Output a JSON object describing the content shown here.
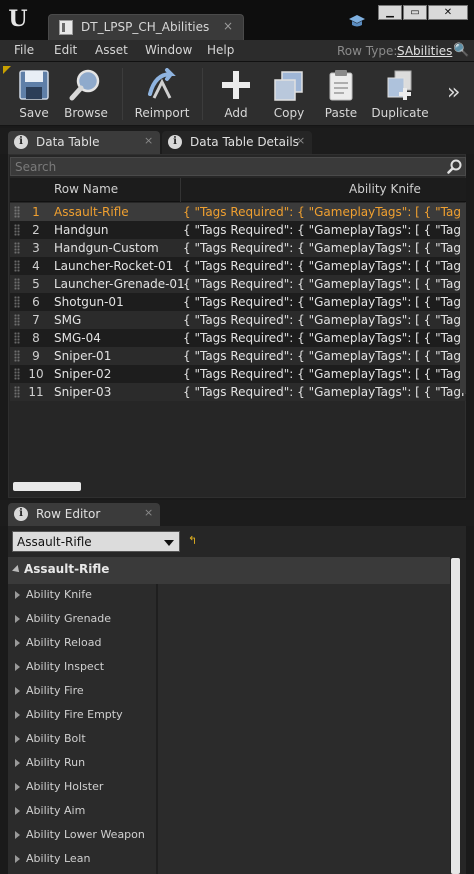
{
  "window": {
    "tab_title": "DT_LPSP_CH_Abilities",
    "close_glyph": "×",
    "min_glyph": "▁",
    "max_glyph": "▭",
    "exit_glyph": "✕"
  },
  "menu": {
    "items": [
      "File",
      "Edit",
      "Asset",
      "Window",
      "Help"
    ],
    "row_type_label": "Row Type:",
    "row_type_value": "SAbilities"
  },
  "toolbar": {
    "buttons": [
      {
        "label": "Save",
        "icon": "save-icon"
      },
      {
        "label": "Browse",
        "icon": "browse-icon"
      },
      {
        "label": "Reimport",
        "icon": "reimport-icon"
      },
      {
        "label": "Add",
        "icon": "add-icon"
      },
      {
        "label": "Copy",
        "icon": "copy-icon"
      },
      {
        "label": "Paste",
        "icon": "paste-icon"
      },
      {
        "label": "Duplicate",
        "icon": "duplicate-icon"
      }
    ],
    "more_glyph": "»"
  },
  "panels": {
    "data_table_tab": "Data Table",
    "details_tab": "Data Table Details",
    "close_glyph": "×"
  },
  "search": {
    "placeholder": "Search"
  },
  "grid": {
    "columns": [
      "Row Name",
      "Ability Knife"
    ],
    "rows": [
      {
        "num": "1",
        "name": "Assault-Rifle",
        "value": "{ \"Tags Required\": { \"GameplayTags\": [ { \"TagName\":",
        "selected": true
      },
      {
        "num": "2",
        "name": "Handgun",
        "value": "{ \"Tags Required\": { \"GameplayTags\": [ { \"TagName\":"
      },
      {
        "num": "3",
        "name": "Handgun-Custom",
        "value": "{ \"Tags Required\": { \"GameplayTags\": [ { \"TagName\":"
      },
      {
        "num": "4",
        "name": "Launcher-Rocket-01",
        "value": "{ \"Tags Required\": { \"GameplayTags\": [ { \"TagName\":"
      },
      {
        "num": "5",
        "name": "Launcher-Grenade-01",
        "value": "{ \"Tags Required\": { \"GameplayTags\": [ { \"TagName\":"
      },
      {
        "num": "6",
        "name": "Shotgun-01",
        "value": "{ \"Tags Required\": { \"GameplayTags\": [ { \"TagName\":"
      },
      {
        "num": "7",
        "name": "SMG",
        "value": "{ \"Tags Required\": { \"GameplayTags\": [ { \"TagName\":"
      },
      {
        "num": "8",
        "name": "SMG-04",
        "value": "{ \"Tags Required\": { \"GameplayTags\": [ { \"TagName\":"
      },
      {
        "num": "9",
        "name": "Sniper-01",
        "value": "{ \"Tags Required\": { \"GameplayTags\": [ { \"TagName\":"
      },
      {
        "num": "10",
        "name": "Sniper-02",
        "value": "{ \"Tags Required\": { \"GameplayTags\": [ { \"TagName\":"
      },
      {
        "num": "11",
        "name": "Sniper-03",
        "value": "{ \"Tags Required\": { \"GameplayTags\": [ { \"TagName\":"
      }
    ]
  },
  "row_editor": {
    "tab": "Row Editor",
    "selected_row": "Assault-Rifle",
    "reset_glyph": "↰",
    "category": "Assault-Rifle",
    "properties": [
      "Ability Knife",
      "Ability Grenade",
      "Ability Reload",
      "Ability Inspect",
      "Ability Fire",
      "Ability Fire Empty",
      "Ability Bolt",
      "Ability Run",
      "Ability Holster",
      "Ability Aim",
      "Ability Lower Weapon",
      "Ability Lean"
    ]
  },
  "colors": {
    "selected_row_text": "#f0a030",
    "background": "#1a1a1a"
  }
}
